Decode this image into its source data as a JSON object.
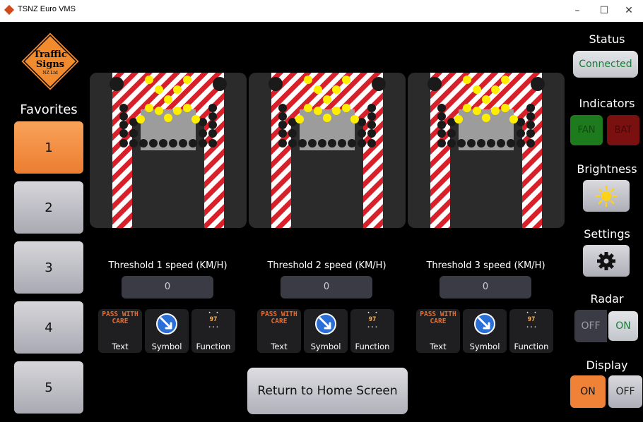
{
  "window": {
    "title": "TSNZ Euro VMS",
    "minimize": "–",
    "maximize": "☐",
    "close": "✕"
  },
  "logo": {
    "line1": "Traffic",
    "line2": "Signs",
    "line3": "NZ Ltd"
  },
  "favorites": {
    "title": "Favorites",
    "items": [
      {
        "label": "1",
        "active": true
      },
      {
        "label": "2",
        "active": false
      },
      {
        "label": "3",
        "active": false
      },
      {
        "label": "4",
        "active": false
      },
      {
        "label": "5",
        "active": false
      }
    ]
  },
  "thresholds": [
    {
      "label": "Threshold 1 speed (KM/H)",
      "value": "0",
      "modes": [
        {
          "label": "Text",
          "preview": [
            "PASS WITH",
            "CARE"
          ]
        },
        {
          "label": "Symbol"
        },
        {
          "label": "Function",
          "preview": [
            "97",
            "..."
          ]
        }
      ]
    },
    {
      "label": "Threshold 2 speed (KM/H)",
      "value": "0",
      "modes": [
        {
          "label": "Text",
          "preview": [
            "PASS WITH",
            "CARE"
          ]
        },
        {
          "label": "Symbol"
        },
        {
          "label": "Function",
          "preview": [
            "97",
            "..."
          ]
        }
      ]
    },
    {
      "label": "Threshold 3 speed (KM/H)",
      "value": "0",
      "modes": [
        {
          "label": "Text",
          "preview": [
            "PASS WITH",
            "CARE"
          ]
        },
        {
          "label": "Symbol"
        },
        {
          "label": "Function",
          "preview": [
            "97",
            "..."
          ]
        }
      ]
    }
  ],
  "home_button": "Return to Home Screen",
  "right_panel": {
    "status": {
      "title": "Status",
      "value": "Connected"
    },
    "indicators": {
      "title": "Indicators",
      "fan": "FAN",
      "bat": "BAT"
    },
    "brightness": {
      "title": "Brightness",
      "icon": "sun-icon"
    },
    "settings": {
      "title": "Settings",
      "icon": "gear-icon"
    },
    "radar": {
      "title": "Radar",
      "off": "OFF",
      "on": "ON",
      "state": "ON"
    },
    "display": {
      "title": "Display",
      "on": "ON",
      "off": "OFF",
      "state": "ON"
    }
  },
  "colors": {
    "active_orange": "#ef8236",
    "indicator_green": "#1d7a1d",
    "indicator_red": "#7a1010",
    "chevron_red": "#d8202a",
    "lamp_yellow": "#ffee00"
  }
}
